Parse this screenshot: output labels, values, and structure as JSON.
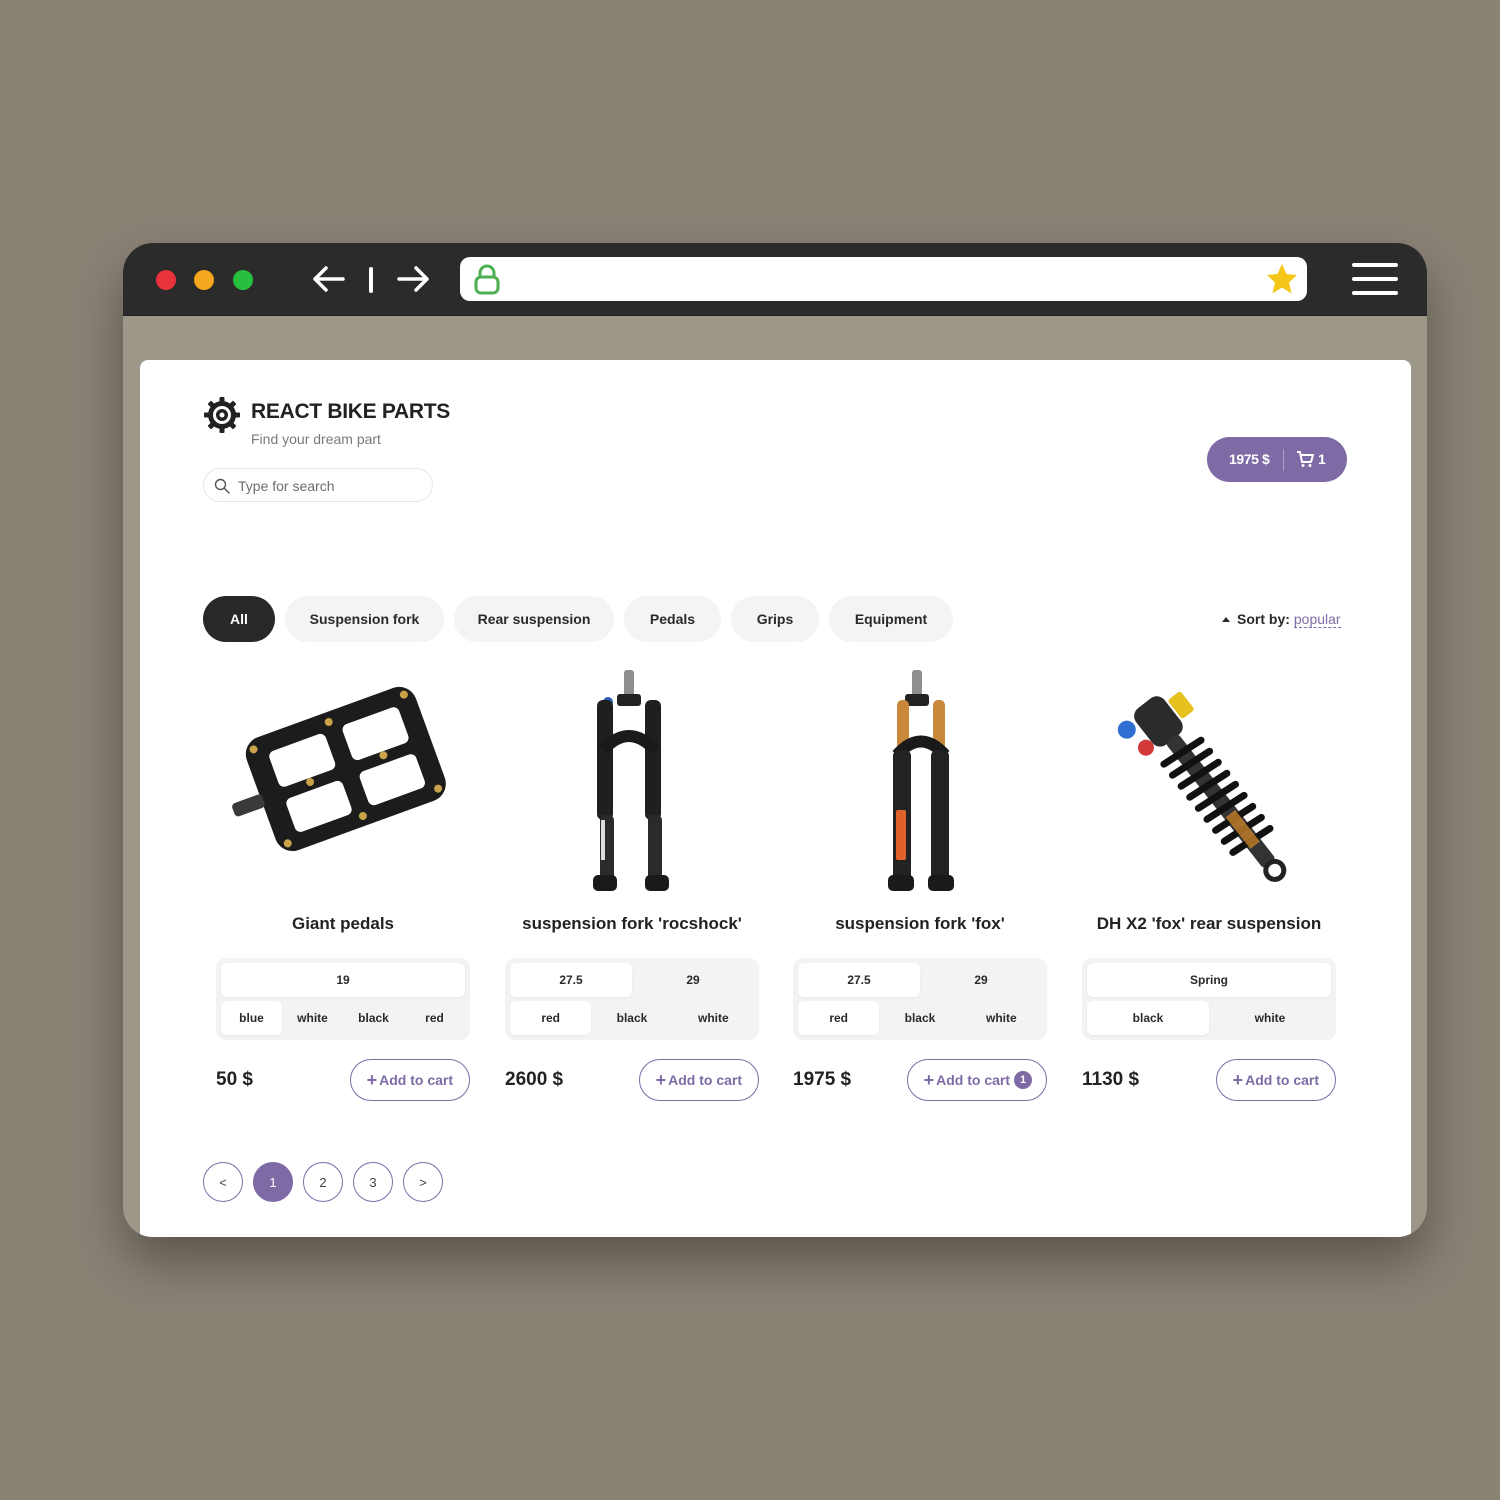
{
  "browser": {
    "icons": [
      "back-arrow-icon",
      "forward-arrow-icon",
      "lock-icon",
      "star-icon",
      "hamburger-menu-icon"
    ],
    "colors": {
      "chrome": "#2b2b2b",
      "close": "#e8323c",
      "minimize": "#f4a61f",
      "maximize": "#27c03e",
      "lock": "#4caf50",
      "star": "#f5c518"
    }
  },
  "header": {
    "brand": "REACT BIKE PARTS",
    "tagline": "Find your dream part",
    "search_placeholder": "Type for search"
  },
  "cart": {
    "total": "1975 $",
    "count": "1"
  },
  "categories": [
    "All",
    "Suspension fork",
    "Rear suspension",
    "Pedals",
    "Grips",
    "Equipment"
  ],
  "active_category": "All",
  "sort": {
    "label": "Sort by:",
    "value": "popular"
  },
  "products": [
    {
      "name": "Giant pedals",
      "options_row1": [
        "19"
      ],
      "options_row2": [
        "blue",
        "white",
        "black",
        "red"
      ],
      "selected_row1": "19",
      "selected_row2": "blue",
      "price": "50 $",
      "add_label": "Add to cart",
      "in_cart": null
    },
    {
      "name": "suspension fork 'rocshock'",
      "options_row1": [
        "27.5",
        "29"
      ],
      "options_row2": [
        "red",
        "black",
        "white"
      ],
      "selected_row1": "27.5",
      "selected_row2": "red",
      "price": "2600 $",
      "add_label": "Add to cart",
      "in_cart": null
    },
    {
      "name": "suspension fork 'fox'",
      "options_row1": [
        "27.5",
        "29"
      ],
      "options_row2": [
        "red",
        "black",
        "white"
      ],
      "selected_row1": "27.5",
      "selected_row2": "red",
      "price": "1975 $",
      "add_label": "Add to cart",
      "in_cart": "1"
    },
    {
      "name": "DH X2 'fox' rear suspension",
      "options_row1": [
        "Spring"
      ],
      "options_row2": [
        "black",
        "white"
      ],
      "selected_row1": "Spring",
      "selected_row2": "black",
      "price": "1130 $",
      "add_label": "Add to cart",
      "in_cart": null
    }
  ],
  "pagination": {
    "prev": "<",
    "pages": [
      "1",
      "2",
      "3"
    ],
    "current": "1",
    "next": ">"
  },
  "accent_color": "#7e6ba5"
}
